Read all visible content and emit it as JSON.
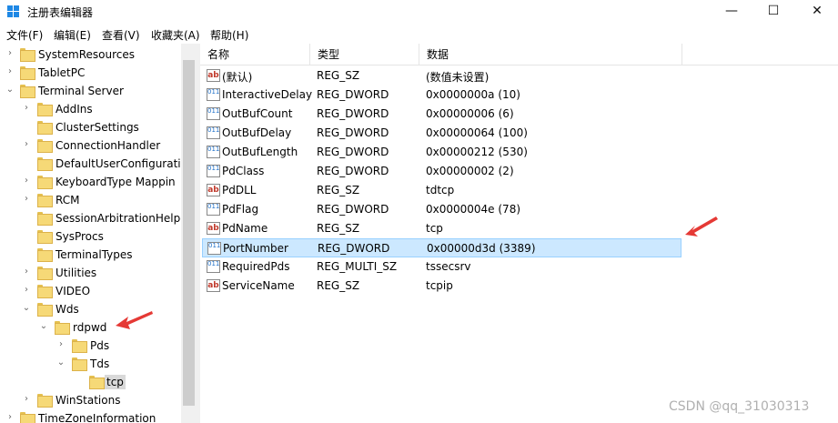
{
  "window": {
    "title": "注册表编辑器",
    "minimize": "—",
    "maximize": "☐",
    "close": "✕"
  },
  "menu": [
    "文件(F)",
    "编辑(E)",
    "查看(V)",
    "收藏夹(A)",
    "帮助(H)"
  ],
  "tree": [
    {
      "label": "SystemResources",
      "twisty": "›"
    },
    {
      "label": "TabletPC",
      "twisty": "›"
    },
    {
      "label": "Terminal Server",
      "twisty": "⌄"
    },
    {
      "label": "AddIns",
      "twisty": "›"
    },
    {
      "label": "ClusterSettings",
      "twisty": ""
    },
    {
      "label": "ConnectionHandler",
      "twisty": "›"
    },
    {
      "label": "DefaultUserConfiguratio",
      "twisty": ""
    },
    {
      "label": "KeyboardType Mappin",
      "twisty": "›"
    },
    {
      "label": "RCM",
      "twisty": "›"
    },
    {
      "label": "SessionArbitrationHelpe",
      "twisty": ""
    },
    {
      "label": "SysProcs",
      "twisty": ""
    },
    {
      "label": "TerminalTypes",
      "twisty": ""
    },
    {
      "label": "Utilities",
      "twisty": "›"
    },
    {
      "label": "VIDEO",
      "twisty": "›"
    },
    {
      "label": "Wds",
      "twisty": "⌄"
    },
    {
      "label": "rdpwd",
      "twisty": "⌄"
    },
    {
      "label": "Pds",
      "twisty": "›"
    },
    {
      "label": "Tds",
      "twisty": "⌄"
    },
    {
      "label": "tcp",
      "twisty": ""
    },
    {
      "label": "WinStations",
      "twisty": "›"
    },
    {
      "label": "TimeZoneInformation",
      "twisty": "›"
    }
  ],
  "list": {
    "columns": [
      "名称",
      "类型",
      "数据"
    ],
    "rows": [
      {
        "icon": "ab",
        "name": "(默认)",
        "type": "REG_SZ",
        "data": "(数值未设置)"
      },
      {
        "icon": "011",
        "name": "InteractiveDelay",
        "type": "REG_DWORD",
        "data": "0x0000000a (10)"
      },
      {
        "icon": "011",
        "name": "OutBufCount",
        "type": "REG_DWORD",
        "data": "0x00000006 (6)"
      },
      {
        "icon": "011",
        "name": "OutBufDelay",
        "type": "REG_DWORD",
        "data": "0x00000064 (100)"
      },
      {
        "icon": "011",
        "name": "OutBufLength",
        "type": "REG_DWORD",
        "data": "0x00000212 (530)"
      },
      {
        "icon": "011",
        "name": "PdClass",
        "type": "REG_DWORD",
        "data": "0x00000002 (2)"
      },
      {
        "icon": "ab",
        "name": "PdDLL",
        "type": "REG_SZ",
        "data": "tdtcp"
      },
      {
        "icon": "011",
        "name": "PdFlag",
        "type": "REG_DWORD",
        "data": "0x0000004e (78)"
      },
      {
        "icon": "ab",
        "name": "PdName",
        "type": "REG_SZ",
        "data": "tcp"
      },
      {
        "icon": "011",
        "name": "PortNumber",
        "type": "REG_DWORD",
        "data": "0x00000d3d (3389)"
      },
      {
        "icon": "011",
        "name": "RequiredPds",
        "type": "REG_MULTI_SZ",
        "data": "tssecsrv"
      },
      {
        "icon": "ab",
        "name": "ServiceName",
        "type": "REG_SZ",
        "data": "tcpip"
      }
    ]
  },
  "watermark": "CSDN @qq_31030313",
  "colors": {
    "selection": "#cce8ff",
    "arrow": "#e53935",
    "folder": "#f6d977"
  }
}
